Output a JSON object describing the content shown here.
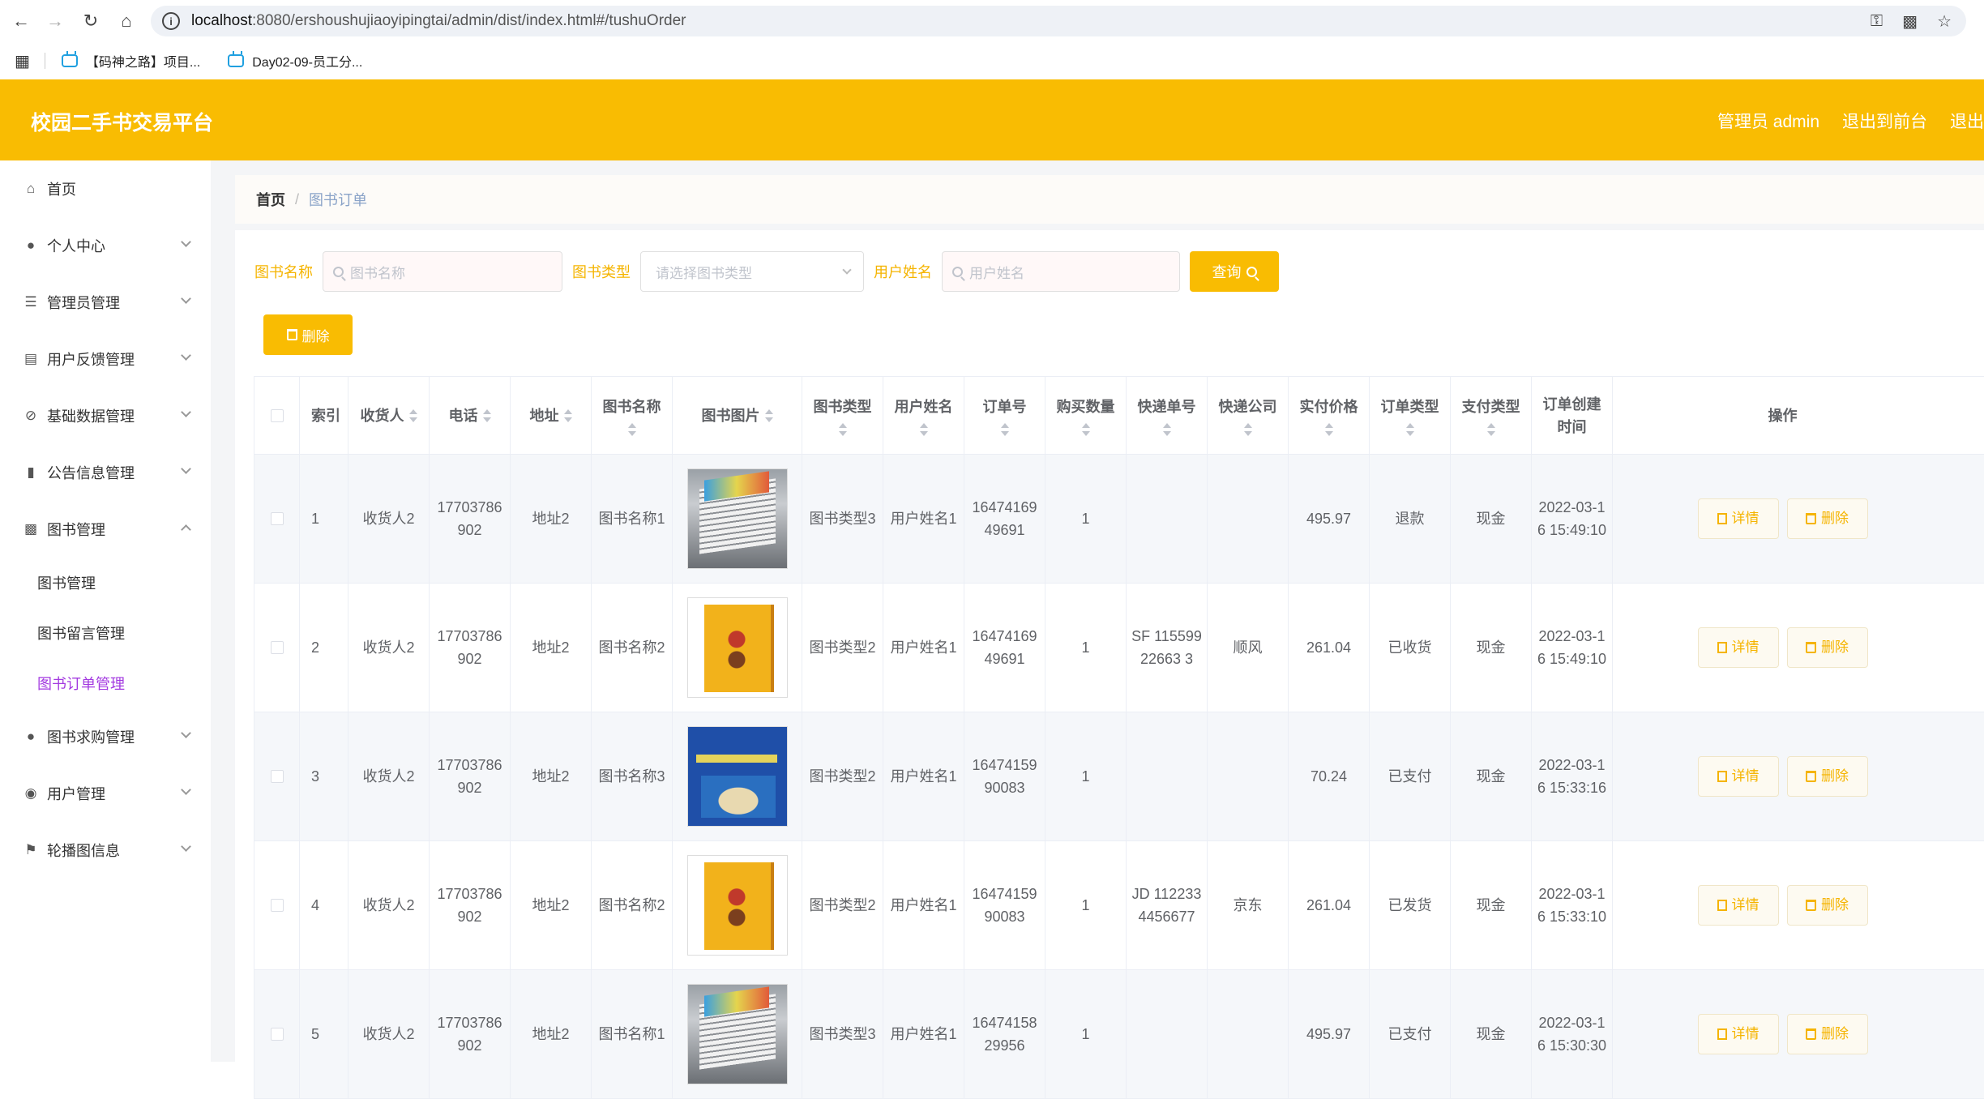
{
  "browser": {
    "url_host": "localhost",
    "url_rest": ":8080/ershoushujiaoyipingtai/admin/dist/index.html#/tushuOrder",
    "bookmarks": [
      "【码神之路】项目...",
      "Day02-09-员工分..."
    ]
  },
  "header": {
    "title": "校园二手书交易平台",
    "links": [
      "管理员 admin",
      "退出到前台",
      "退出"
    ]
  },
  "sidebar": {
    "items": [
      {
        "label": "首页",
        "icon": "home-icon",
        "chevron": ""
      },
      {
        "label": "个人中心",
        "icon": "user-icon",
        "chevron": "down"
      },
      {
        "label": "管理员管理",
        "icon": "sliders-icon",
        "chevron": "down"
      },
      {
        "label": "用户反馈管理",
        "icon": "clipboard-icon",
        "chevron": "down"
      },
      {
        "label": "基础数据管理",
        "icon": "bell-off-icon",
        "chevron": "down"
      },
      {
        "label": "公告信息管理",
        "icon": "video-icon",
        "chevron": "down"
      },
      {
        "label": "图书管理",
        "icon": "bar-chart-icon",
        "chevron": "up"
      },
      {
        "label": "图书求购管理",
        "icon": "user-icon",
        "chevron": "down"
      },
      {
        "label": "用户管理",
        "icon": "bulb-icon",
        "chevron": "down"
      },
      {
        "label": "轮播图信息",
        "icon": "flag-icon",
        "chevron": "down"
      }
    ],
    "sub_items": [
      "图书管理",
      "图书留言管理",
      "图书订单管理"
    ],
    "active_sub": "图书订单管理"
  },
  "breadcrumb": {
    "home": "首页",
    "separator": "/",
    "current": "图书订单"
  },
  "search": {
    "book_name_label": "图书名称",
    "book_name_placeholder": "图书名称",
    "book_type_label": "图书类型",
    "book_type_placeholder": "请选择图书类型",
    "user_name_label": "用户姓名",
    "user_name_placeholder": "用户姓名",
    "query_button": "查询"
  },
  "batch_delete_button": "删除",
  "table": {
    "headers": {
      "index": "索引",
      "receiver": "收货人",
      "phone": "电话",
      "address": "地址",
      "book_name": "图书名称",
      "book_image": "图书图片",
      "book_type": "图书类型",
      "user_name": "用户姓名",
      "order_no": "订单号",
      "quantity": "购买数量",
      "express_no": "快递单号",
      "express_company": "快递公司",
      "price": "实付价格",
      "order_type": "订单类型",
      "pay_type": "支付类型",
      "created": "订单创建时间",
      "ops": "操作"
    },
    "detail_button": "详情",
    "delete_button": "删除",
    "rows": [
      {
        "index": "1",
        "receiver": "收货人2",
        "phone": "17703786902",
        "address": "地址2",
        "book_name": "图书名称1",
        "image": "stack",
        "book_type": "图书类型3",
        "user_name": "用户姓名1",
        "order_no": "1647416949691",
        "quantity": "1",
        "express_no": "",
        "express_company": "",
        "price": "495.97",
        "order_type": "退款",
        "pay_type": "现金",
        "created": "2022-03-16 15:49:10"
      },
      {
        "index": "2",
        "receiver": "收货人2",
        "phone": "17703786902",
        "address": "地址2",
        "book_name": "图书名称2",
        "image": "yellow",
        "book_type": "图书类型2",
        "user_name": "用户姓名1",
        "order_no": "1647416949691",
        "quantity": "1",
        "express_no": "SF 11559922663 3",
        "express_company": "顺风",
        "price": "261.04",
        "order_type": "已收货",
        "pay_type": "现金",
        "created": "2022-03-16 15:49:10"
      },
      {
        "index": "3",
        "receiver": "收货人2",
        "phone": "17703786902",
        "address": "地址2",
        "book_name": "图书名称3",
        "image": "blue",
        "book_type": "图书类型2",
        "user_name": "用户姓名1",
        "order_no": "1647415990083",
        "quantity": "1",
        "express_no": "",
        "express_company": "",
        "price": "70.24",
        "order_type": "已支付",
        "pay_type": "现金",
        "created": "2022-03-16 15:33:16"
      },
      {
        "index": "4",
        "receiver": "收货人2",
        "phone": "17703786902",
        "address": "地址2",
        "book_name": "图书名称2",
        "image": "yellow",
        "book_type": "图书类型2",
        "user_name": "用户姓名1",
        "order_no": "1647415990083",
        "quantity": "1",
        "express_no": "JD 1122334456677",
        "express_company": "京东",
        "price": "261.04",
        "order_type": "已发货",
        "pay_type": "现金",
        "created": "2022-03-16 15:33:10"
      },
      {
        "index": "5",
        "receiver": "收货人2",
        "phone": "17703786902",
        "address": "地址2",
        "book_name": "图书名称1",
        "image": "stack",
        "book_type": "图书类型3",
        "user_name": "用户姓名1",
        "order_no": "1647415829956",
        "quantity": "1",
        "express_no": "",
        "express_company": "",
        "price": "495.97",
        "order_type": "已支付",
        "pay_type": "现金",
        "created": "2022-03-16 15:30:30"
      }
    ]
  },
  "colors": {
    "accent": "#f9bc02",
    "active_menu": "#a33ae0",
    "label": "#f5b400"
  }
}
